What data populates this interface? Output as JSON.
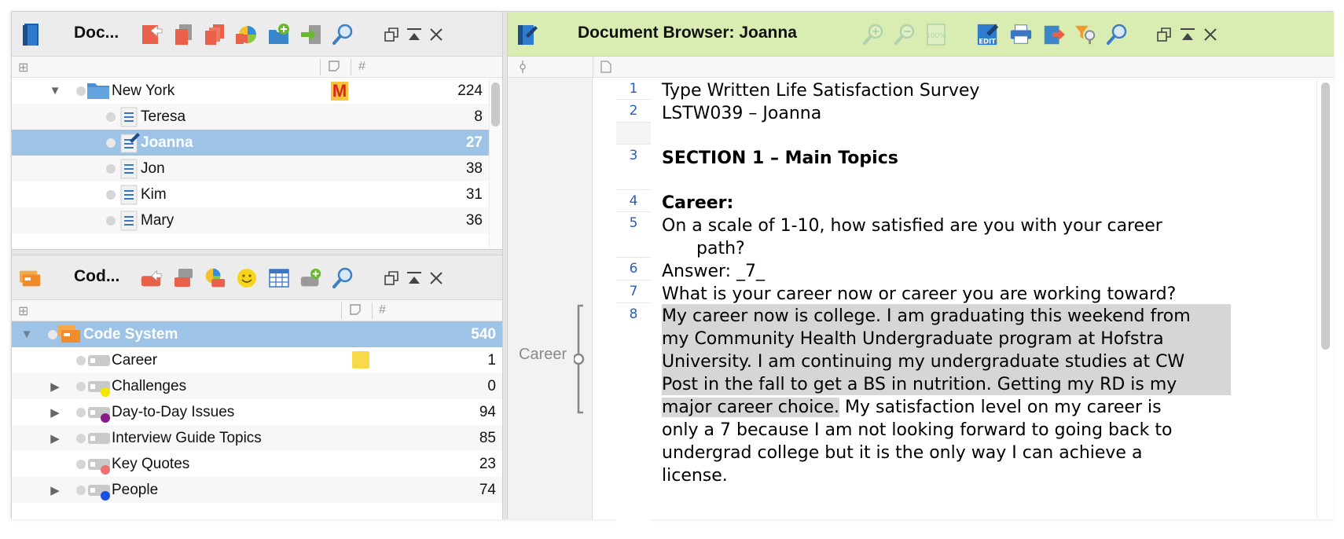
{
  "doc_panel": {
    "title": "Doc...",
    "groups": [
      {
        "name": "New York",
        "memo": "M",
        "count": "224"
      }
    ],
    "documents": [
      {
        "name": "Teresa",
        "count": "8"
      },
      {
        "name": "Joanna",
        "count": "27"
      },
      {
        "name": "Jon",
        "count": "38"
      },
      {
        "name": "Kim",
        "count": "31"
      },
      {
        "name": "Mary",
        "count": "36"
      }
    ]
  },
  "code_panel": {
    "title": "Cod...",
    "root": {
      "name": "Code System",
      "count": "540"
    },
    "codes": [
      {
        "name": "Career",
        "count": "1",
        "color": "",
        "has_memo": true,
        "expandable": false
      },
      {
        "name": "Challenges",
        "count": "0",
        "color": "#f5e600",
        "expandable": true
      },
      {
        "name": "Day-to-Day Issues",
        "count": "94",
        "color": "#8a1a8a",
        "expandable": true
      },
      {
        "name": "Interview Guide Topics",
        "count": "85",
        "color": "",
        "expandable": true
      },
      {
        "name": "Key Quotes",
        "count": "23",
        "color": "#f07070",
        "expandable": false
      },
      {
        "name": "People",
        "count": "74",
        "color": "#1a4ee6",
        "expandable": true
      }
    ]
  },
  "browser": {
    "title": "Document Browser: Joanna",
    "code_stripe_label": "Career",
    "line_numbers": [
      "1",
      "2",
      "3",
      "4",
      "5",
      "6",
      "7",
      "8"
    ],
    "lines": {
      "l1": "Type Written Life Satisfaction Survey",
      "l2": "LSTW039 – Joanna",
      "l3": "SECTION 1 – Main Topics",
      "l4": "Career:",
      "l5a": "On a scale of 1-10, how satisfied are you with your career",
      "l5b": "path?",
      "l6": "Answer: _7_",
      "l7": "What is your career now or career you are working toward?",
      "l8a": "My career now is college. I am graduating this weekend from",
      "l8b": "my Community Health Undergraduate program at Hofstra",
      "l8c": "University.  I am continuing my undergraduate studies at CW",
      "l8d": "Post in the fall to get a BS in nutrition.  Getting my RD is my",
      "l8e_hl": "major career choice.",
      "l8e_rest": "  My satisfaction level on my career is",
      "l8f": "only a 7 because I am not looking forward to going back to",
      "l8g": "undergrad college but it is the only way I can achieve a",
      "l8h": "license."
    },
    "toolbar": {
      "edit_label": "EDIT",
      "zoom_reset_label": "100%"
    }
  },
  "colors": {
    "selection": "#9dc3e6",
    "browser_header": "#d9ecb2",
    "line_number": "#2a5dbd",
    "coded_highlight": "#d6d6d6"
  }
}
